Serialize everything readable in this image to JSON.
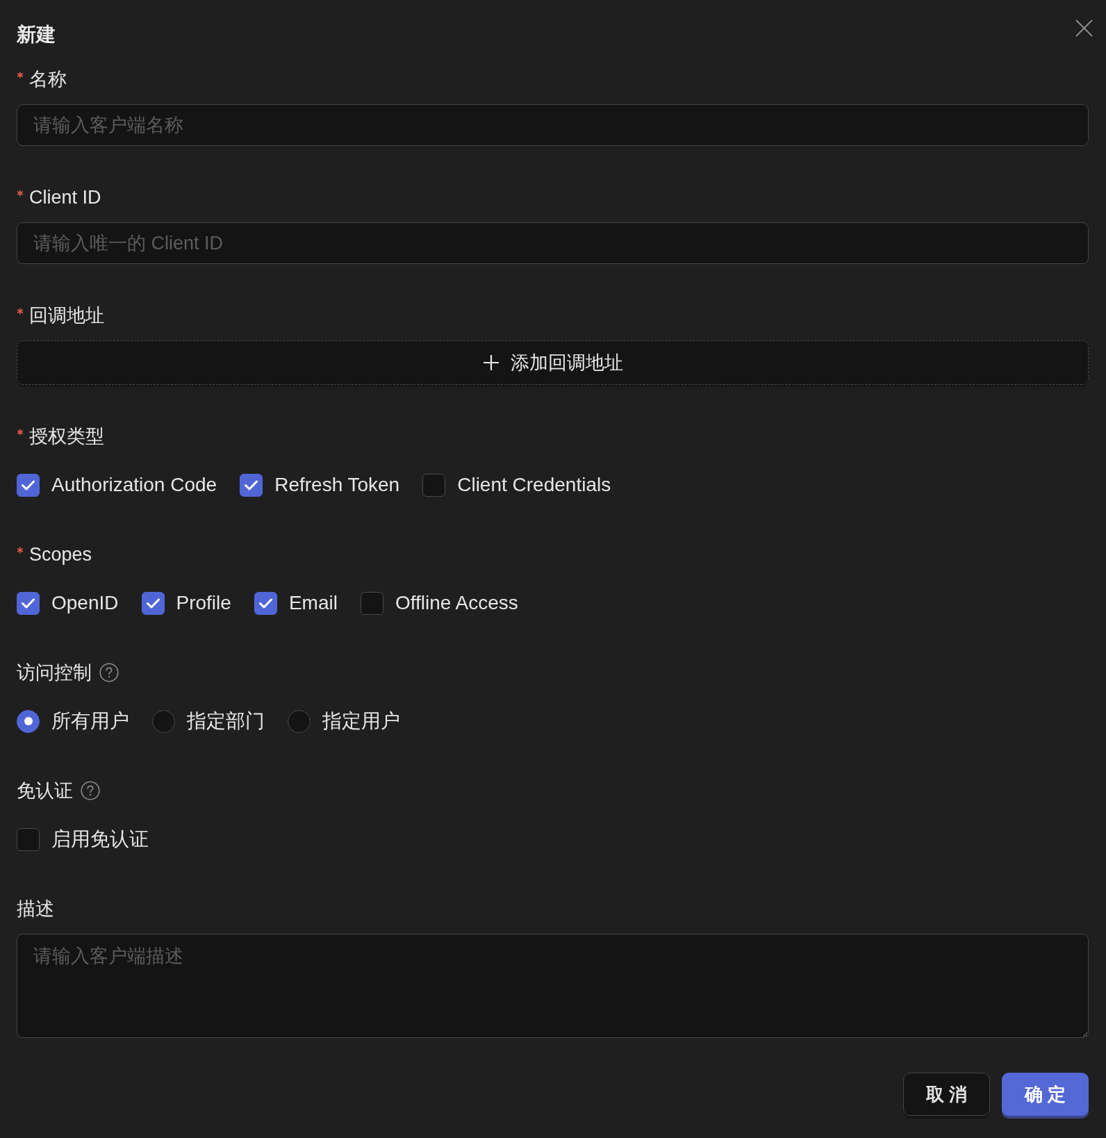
{
  "dialog": {
    "title": "新建"
  },
  "fields": [
    {
      "kind": "text",
      "label": "名称",
      "required": true,
      "placeholder": "请输入客户端名称"
    },
    {
      "kind": "text",
      "label": "Client ID",
      "required": true,
      "placeholder": "请输入唯一的 Client ID"
    },
    {
      "kind": "add",
      "label": "回调地址",
      "required": true,
      "button": "添加回调地址"
    },
    {
      "kind": "checkboxes",
      "label": "授权类型",
      "required": true,
      "options": [
        {
          "label": "Authorization Code",
          "checked": true
        },
        {
          "label": "Refresh Token",
          "checked": true
        },
        {
          "label": "Client Credentials",
          "checked": false
        }
      ]
    },
    {
      "kind": "checkboxes",
      "label": "Scopes",
      "required": true,
      "options": [
        {
          "label": "OpenID",
          "checked": true
        },
        {
          "label": "Profile",
          "checked": true
        },
        {
          "label": "Email",
          "checked": true
        },
        {
          "label": "Offline Access",
          "checked": false
        }
      ]
    },
    {
      "kind": "radios",
      "label": "访问控制",
      "required": false,
      "help": true,
      "options": [
        {
          "label": "所有用户",
          "selected": true
        },
        {
          "label": "指定部门",
          "selected": false
        },
        {
          "label": "指定用户",
          "selected": false
        }
      ]
    },
    {
      "kind": "checkboxes",
      "label": "免认证",
      "required": false,
      "help": true,
      "options": [
        {
          "label": "启用免认证",
          "checked": false
        }
      ]
    },
    {
      "kind": "textarea",
      "label": "描述",
      "required": false,
      "placeholder": "请输入客户端描述"
    }
  ],
  "buttons": [
    {
      "kind": "default",
      "label": "取 消"
    },
    {
      "kind": "primary",
      "label": "确 定"
    }
  ]
}
